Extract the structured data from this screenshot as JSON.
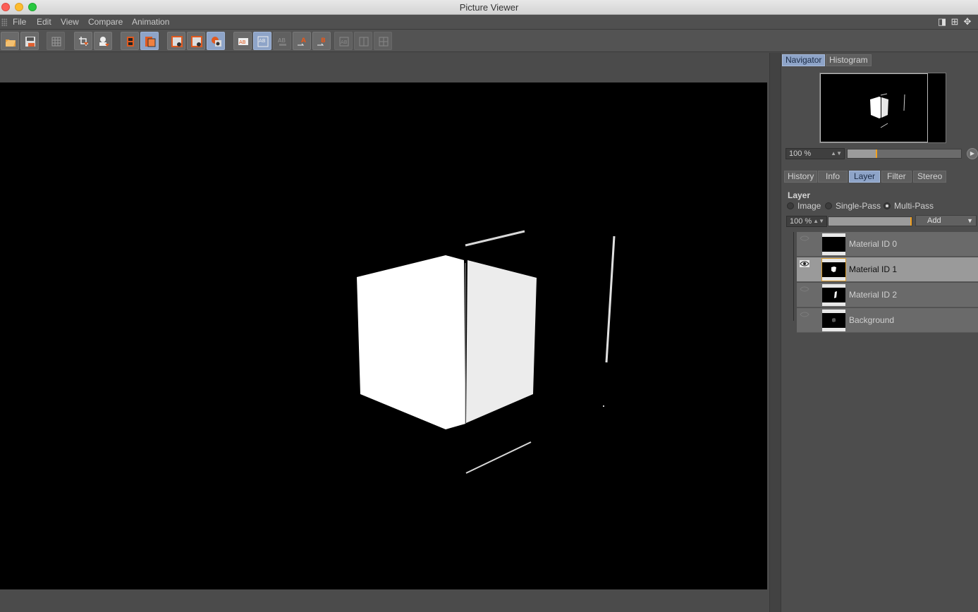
{
  "window": {
    "title": "Picture Viewer"
  },
  "menu": {
    "items": [
      "File",
      "Edit",
      "View",
      "Compare",
      "Animation"
    ]
  },
  "colors": {
    "accent": "#8ea4c8",
    "marker": "#f0a020",
    "panel": "#4d4d4d",
    "canvas": "#000000"
  },
  "navigator": {
    "tabs": [
      "Navigator",
      "Histogram"
    ],
    "active_tab": "Navigator",
    "zoom_value": "100 %"
  },
  "panel_tabs": {
    "items": [
      "History",
      "Info",
      "Layer",
      "Filter",
      "Stereo"
    ],
    "active": "Layer"
  },
  "layer": {
    "title": "Layer",
    "modes": [
      "Image",
      "Single-Pass",
      "Multi-Pass"
    ],
    "selected_mode": "Multi-Pass",
    "opacity_value": "100 %",
    "add_label": "Add",
    "rows": [
      {
        "name": "Material ID 0",
        "visible": false,
        "selected": false
      },
      {
        "name": "Material ID 1",
        "visible": true,
        "selected": true
      },
      {
        "name": "Material ID 2",
        "visible": false,
        "selected": false
      },
      {
        "name": "Background",
        "visible": false,
        "selected": false
      }
    ]
  },
  "toolbar": {
    "icons": [
      "open-file-icon",
      "save-file-icon",
      "grid-icon",
      "crop-down-icon",
      "user-down-icon",
      "film-strip-icon",
      "film-strip-stack-icon",
      "compare-left-icon",
      "compare-right-icon",
      "compare-eye-icon",
      "ab-icon",
      "ab-split-icon",
      "ab-swap-icon",
      "set-a-icon",
      "set-b-icon",
      "split-grid-1-icon",
      "split-grid-2-icon",
      "split-grid-3-icon"
    ]
  }
}
